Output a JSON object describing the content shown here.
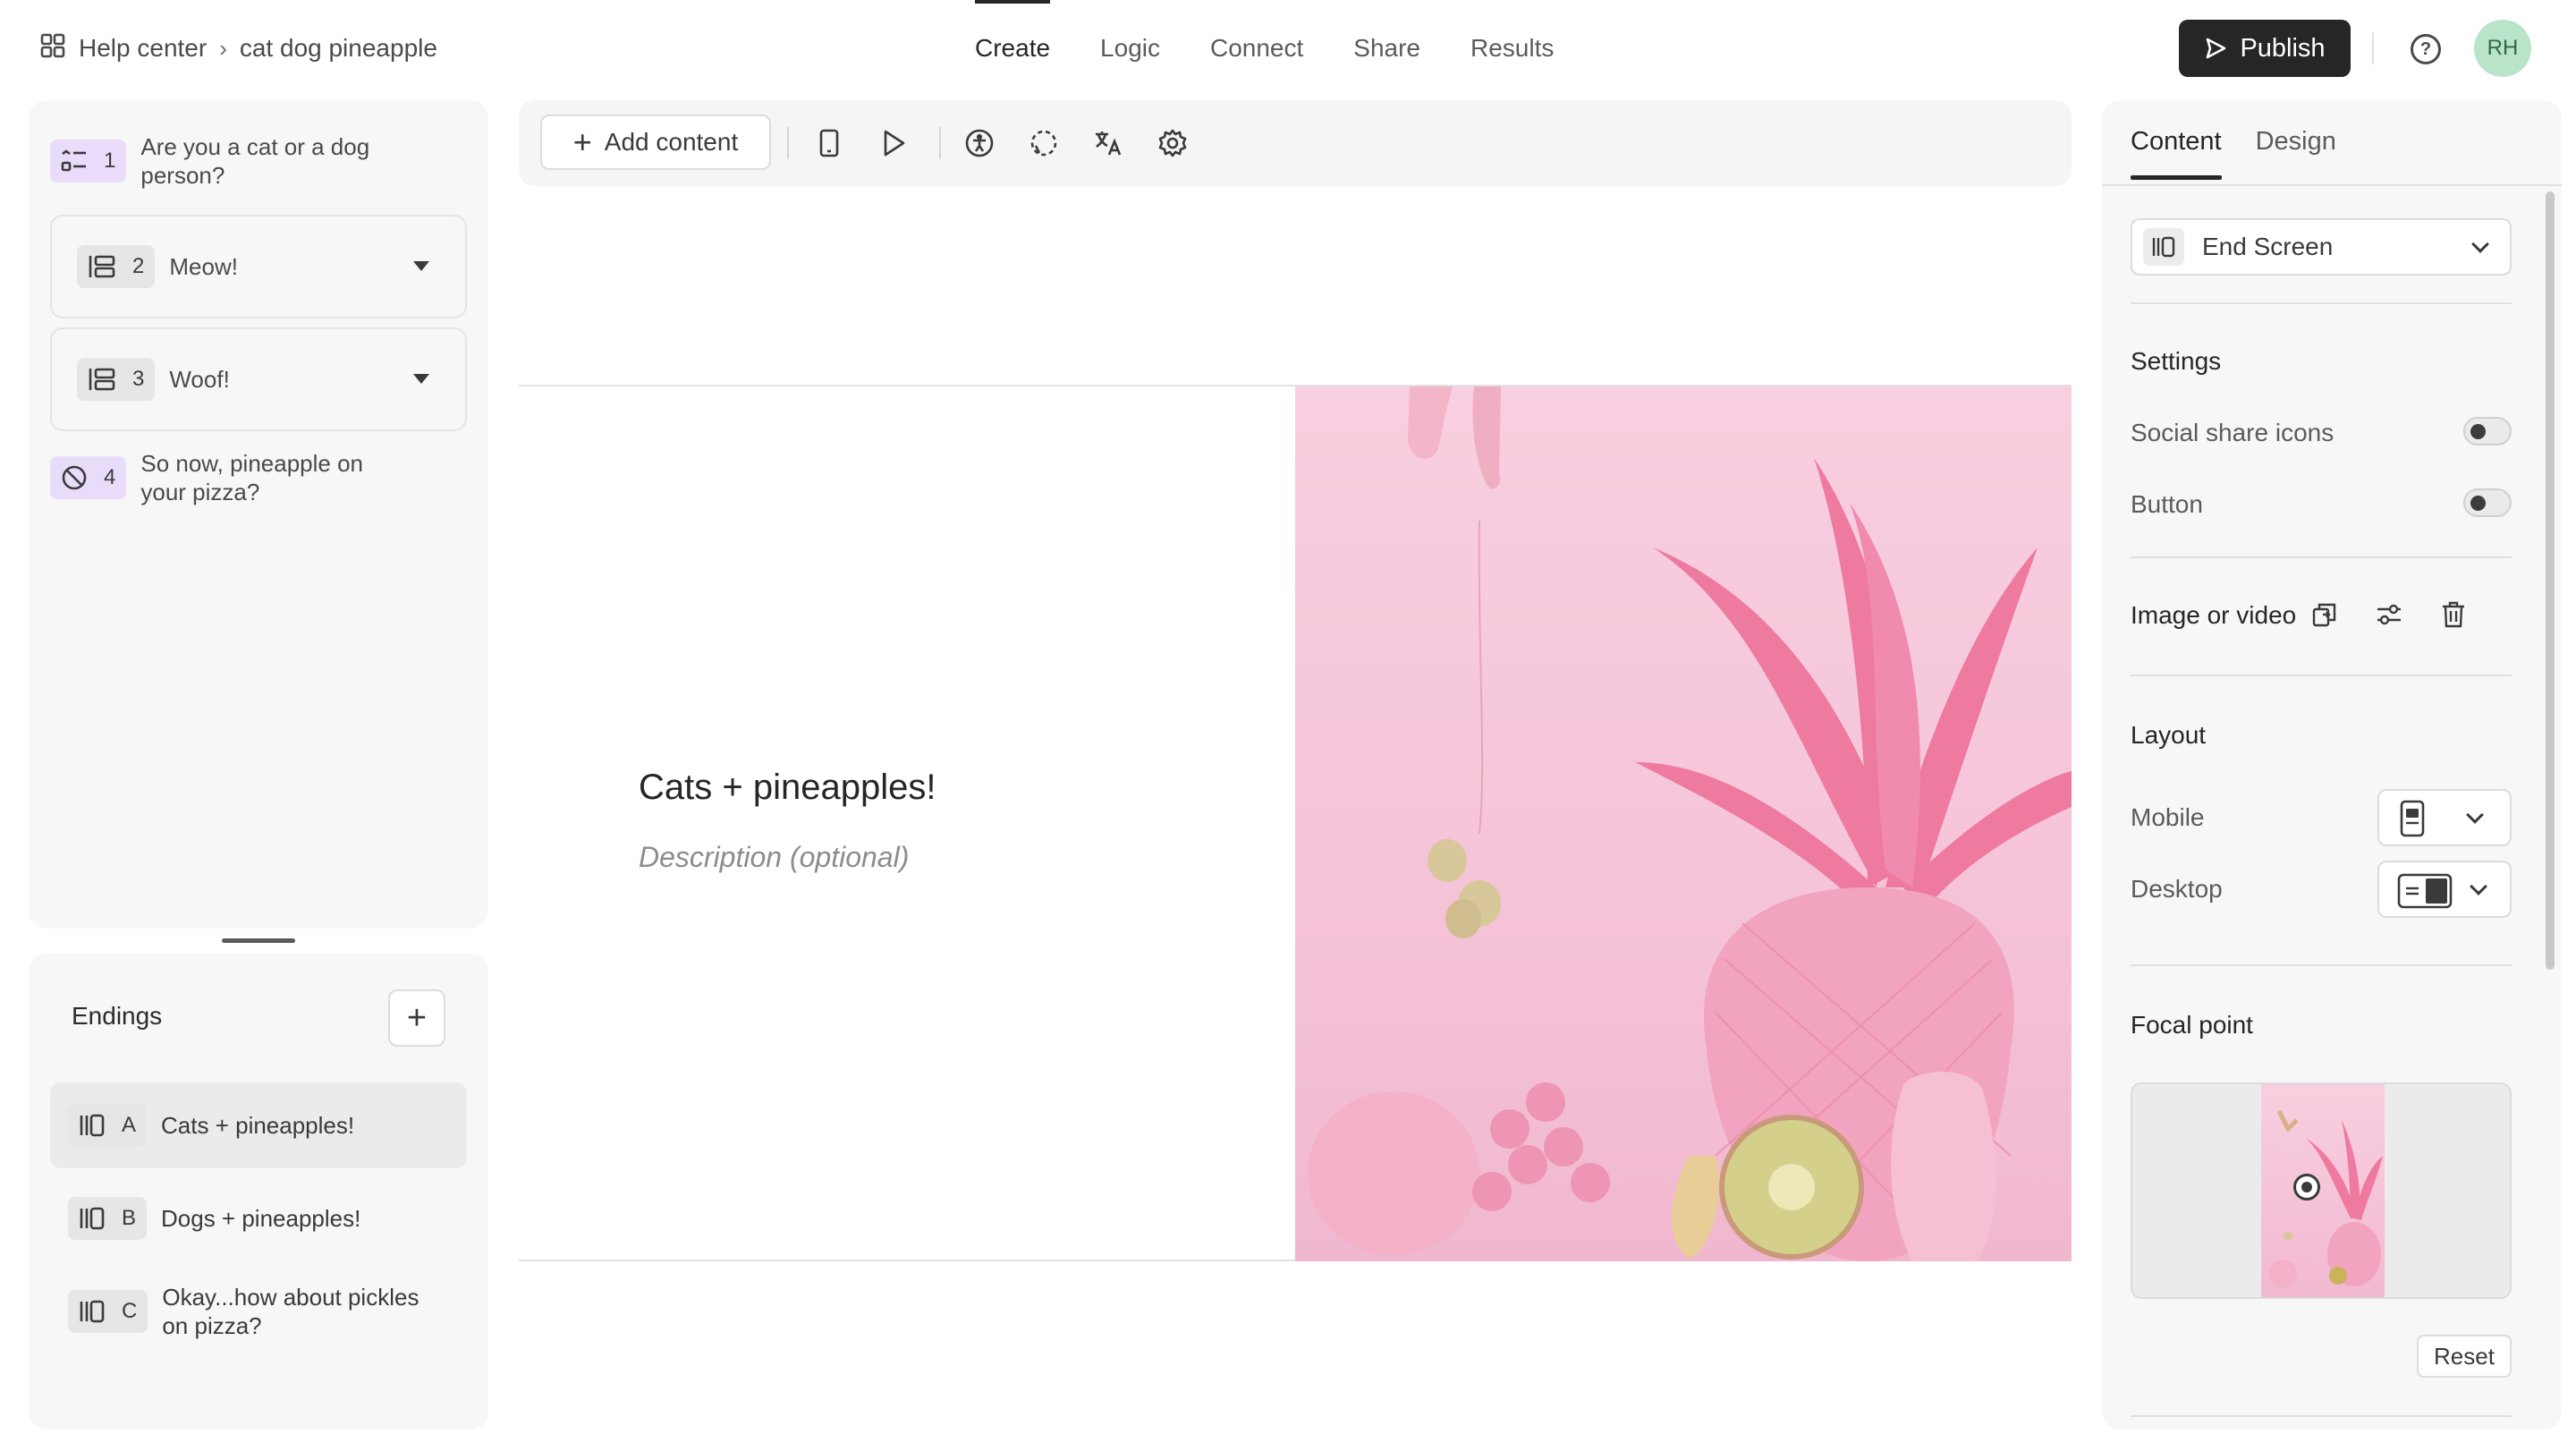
{
  "header": {
    "breadcrumb": {
      "home": "Help center",
      "separator": "›",
      "current": "cat dog pineapple"
    },
    "tabs": [
      {
        "label": "Create",
        "active": true
      },
      {
        "label": "Logic",
        "active": false
      },
      {
        "label": "Connect",
        "active": false
      },
      {
        "label": "Share",
        "active": false
      },
      {
        "label": "Results",
        "active": false
      }
    ],
    "publish_label": "Publish",
    "avatar_initials": "RH"
  },
  "questions": [
    {
      "number": "1",
      "text": "Are you a cat or a dog person?",
      "icon": "list-icon",
      "color": "#e9dcfb"
    },
    {
      "number": "2",
      "text": "Meow!",
      "icon": "group-icon",
      "color": "#e6e6e6"
    },
    {
      "number": "3",
      "text": "Woof!",
      "icon": "group-icon",
      "color": "#e6e6e6"
    },
    {
      "number": "4",
      "text": "So now, pineapple on your pizza?",
      "icon": "no-icon",
      "color": "#e9dcfb"
    }
  ],
  "endings": {
    "title": "Endings",
    "items": [
      {
        "letter": "A",
        "text": "Cats + pineapples!",
        "selected": true
      },
      {
        "letter": "B",
        "text": "Dogs + pineapples!",
        "selected": false
      },
      {
        "letter": "C",
        "text": "Okay...how about pickles on pizza?",
        "selected": false
      }
    ]
  },
  "toolbar": {
    "add_content_label": "Add content"
  },
  "canvas": {
    "headline": "Cats + pineapples!",
    "description_placeholder": "Description (optional)"
  },
  "right_panel": {
    "tabs": [
      {
        "label": "Content",
        "active": true
      },
      {
        "label": "Design",
        "active": false
      }
    ],
    "screen_type": "End Screen",
    "settings_title": "Settings",
    "social_share_label": "Social share icons",
    "social_share_on": false,
    "button_label": "Button",
    "button_on": false,
    "image_label": "Image or video",
    "layout_title": "Layout",
    "mobile_label": "Mobile",
    "desktop_label": "Desktop",
    "focal_title": "Focal point",
    "reset_label": "Reset"
  },
  "colors": {
    "accent_dark": "#262626",
    "badge_purple": "#e9dcfb",
    "avatar_bg": "#b9e4c9",
    "image_pink": "#f5c3d8"
  }
}
